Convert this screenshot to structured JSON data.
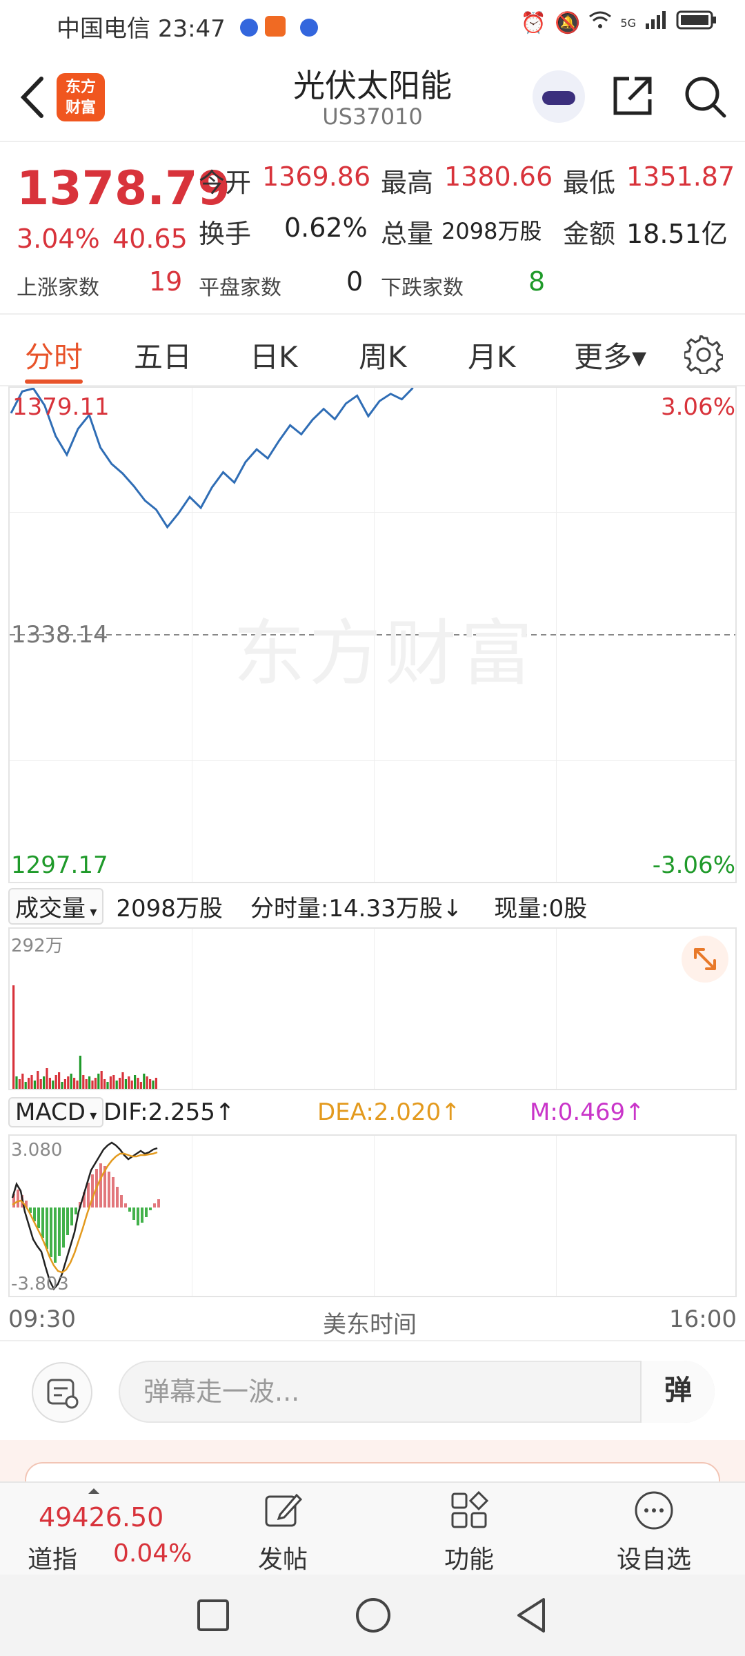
{
  "status_bar": {
    "carrier": "中国电信",
    "time": "23:47",
    "net": "5G"
  },
  "header": {
    "logo_text_1": "东方",
    "logo_text_2": "财富",
    "title": "光伏太阳能",
    "code": "US37010"
  },
  "quote": {
    "price": "1378.79",
    "change_pct": "3.04%",
    "change": "40.65",
    "open_label": "今开",
    "open": "1369.86",
    "high_label": "最高",
    "high": "1380.66",
    "low_label": "最低",
    "low": "1351.87",
    "turnover_label": "换手",
    "turnover": "0.62%",
    "volume_label": "总量",
    "volume": "2098万股",
    "amount_label": "金额",
    "amount": "18.51亿",
    "up_label": "上涨家数",
    "up": "19",
    "flat_label": "平盘家数",
    "flat": "0",
    "down_label": "下跌家数",
    "down": "8"
  },
  "tabs": {
    "items": [
      "分时",
      "五日",
      "日K",
      "周K",
      "月K",
      "更多▾"
    ],
    "active": "分时"
  },
  "price_chart": {
    "top_price": "1379.11",
    "top_pct": "3.06%",
    "mid_price": "1338.14",
    "bottom_price": "1297.17",
    "bottom_pct": "-3.06%",
    "watermark": "东方财富"
  },
  "volume_info": {
    "selector": "成交量",
    "total": "2098万股",
    "minute_volume": "分时量:14.33万股↓",
    "current_volume": "现量:0股",
    "axis_max": "292万"
  },
  "macd_info": {
    "selector": "MACD",
    "dif": "DIF:2.255↑",
    "dea": "DEA:2.020↑",
    "m": "M:0.469↑",
    "axis_max": "3.080",
    "axis_min": "-3.803"
  },
  "time_axis": {
    "start": "09:30",
    "label": "美东时间",
    "end": "16:00"
  },
  "danmaku": {
    "placeholder": "弹幕走一波...",
    "button": "弹"
  },
  "bottom_bar": {
    "index_value": "49426.50",
    "index_name": "道指",
    "index_pct": "0.04%",
    "post_label": "发帖",
    "func_label": "功能",
    "watch_label": "设自选"
  },
  "colors": {
    "accent": "#e8532a",
    "up": "#d8333b",
    "down": "#1f9a2a",
    "price_line": "#2f6db5",
    "dea": "#e39a1e",
    "m": "#c935c9"
  },
  "chart_data": {
    "type": "line",
    "title": "",
    "ylim": [
      1297.17,
      1379.11
    ],
    "reference": 1338.14,
    "series": [
      {
        "values": [
          1374.9,
          1378.5,
          1379.0,
          1376.2,
          1371.1,
          1368.0,
          1372.3,
          1374.6,
          1369.2,
          1366.5,
          1364.9,
          1362.8,
          1360.4,
          1358.9,
          1356.0,
          1358.3,
          1361.0,
          1359.2,
          1362.6,
          1365.1,
          1363.4,
          1366.8,
          1368.9,
          1367.4,
          1370.3,
          1372.9,
          1371.4,
          1373.8,
          1375.6,
          1373.9,
          1376.5,
          1377.8,
          1374.4,
          1376.9,
          1378.1,
          1377.2,
          1379.1
        ]
      }
    ]
  }
}
